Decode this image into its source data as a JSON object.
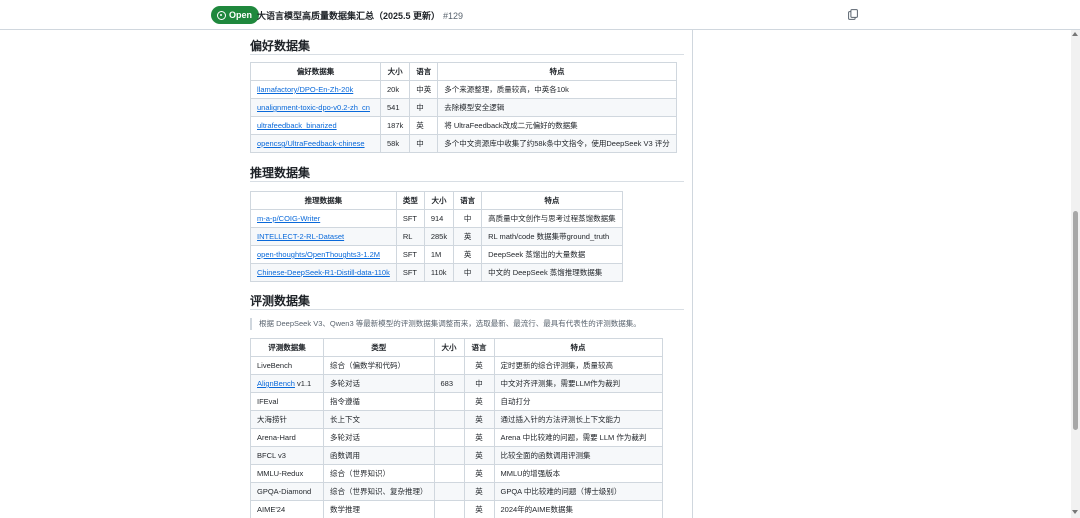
{
  "header": {
    "status": "Open",
    "title": "大语言模型高质量数据集汇总（2025.5 更新）",
    "number": "#129"
  },
  "preference": {
    "heading": "偏好数据集",
    "columns": [
      "偏好数据集",
      "大小",
      "语言",
      "特点"
    ],
    "rows": [
      [
        "llamafactory/DPO-En-Zh-20k",
        "20k",
        "中英",
        "多个来源整理，质量较高，中英各10k"
      ],
      [
        "unalignment-toxic-dpo-v0.2-zh_cn",
        "541",
        "中",
        "去除模型安全逻辑"
      ],
      [
        "ultrafeedback_binarized",
        "187k",
        "英",
        "将 UltraFeedback改成二元偏好的数据集"
      ],
      [
        "opencsg/UltraFeedback-chinese",
        "58k",
        "中",
        "多个中文资源库中收集了约58k条中文指令，使用DeepSeek V3 评分"
      ]
    ]
  },
  "reasoning": {
    "heading": "推理数据集",
    "columns": [
      "推理数据集",
      "类型",
      "大小",
      "语言",
      "特点"
    ],
    "rows": [
      [
        "m-a-p/COIG-Writer",
        "SFT",
        "914",
        "中",
        "高质量中文创作与思考过程蒸馏数据集"
      ],
      [
        "INTELLECT-2-RL-Dataset",
        "RL",
        "285k",
        "英",
        "RL math/code 数据集带ground_truth"
      ],
      [
        "open-thoughts/OpenThoughts3-1.2M",
        "SFT",
        "1M",
        "英",
        "DeepSeek 蒸馏出的大量数据"
      ],
      [
        "Chinese-DeepSeek-R1-Distill-data-110k",
        "SFT",
        "110k",
        "中",
        "中文的 DeepSeek 蒸馏推理数据集"
      ]
    ]
  },
  "evaluation": {
    "heading": "评测数据集",
    "note": "根据 DeepSeek V3、Qwen3 等最新模型的评测数据集调整而来，选取最新、最流行、最具有代表性的评测数据集。",
    "columns": [
      "评测数据集",
      "类型",
      "大小",
      "语言",
      "特点"
    ],
    "rows": [
      [
        "LiveBench",
        "",
        "综合（偏数学和代码）",
        "",
        "英",
        "定时更新的综合评测集，质量较高"
      ],
      [
        "AlignBench",
        " v1.1",
        "多轮对话",
        "683",
        "中",
        "中文对齐评测集，需要LLM作为裁判"
      ],
      [
        "IFEval",
        "",
        "指令遵循",
        "",
        "英",
        "自动打分"
      ],
      [
        "大海捞针",
        "",
        "长上下文",
        "",
        "英",
        "通过插入针的方法评测长上下文能力"
      ],
      [
        "Arena-Hard",
        "",
        "多轮对话",
        "",
        "英",
        "Arena 中比较难的问题，需要 LLM 作为裁判"
      ],
      [
        "BFCL v3",
        "",
        "函数调用",
        "",
        "英",
        "比较全面的函数调用评测集"
      ],
      [
        "MMLU-Redux",
        "",
        "综合（世界知识）",
        "",
        "英",
        "MMLU的增强版本"
      ],
      [
        "GPQA-Diamond",
        "",
        "综合（世界知识、复杂推理）",
        "",
        "英",
        "GPQA 中比较难的问题（博士级别）"
      ],
      [
        "AIME'24",
        "",
        "数学推理",
        "",
        "英",
        "2024年的AIME数据集"
      ]
    ]
  },
  "colors": {
    "open_green": "#1f883d",
    "link_blue": "#0969da",
    "border": "#d0d7de",
    "stripe": "#f6f8fa"
  },
  "icons": [
    "open-issue-icon",
    "copy-icon"
  ]
}
